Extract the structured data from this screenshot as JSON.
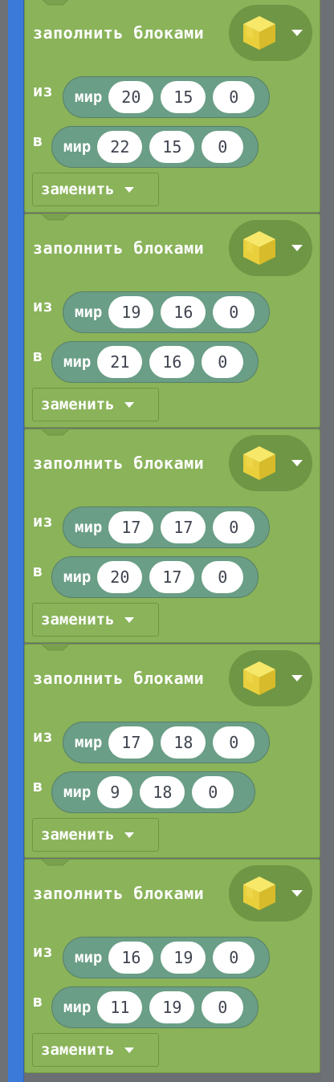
{
  "colors": {
    "block_green": "#8ab35a",
    "position_teal": "#6a9e86",
    "event_blue": "#3b7ad8",
    "cube_yellow": "#f2d844"
  },
  "blocks": [
    {
      "fill_label": "заполнить блоками",
      "block_icon": "gold-block-icon",
      "from_label": "из",
      "to_label": "в",
      "from": {
        "word": "мир",
        "x": "20",
        "y": "15",
        "z": "0"
      },
      "to": {
        "word": "мир",
        "x": "22",
        "y": "15",
        "z": "0"
      },
      "mode": "заменить"
    },
    {
      "fill_label": "заполнить блоками",
      "block_icon": "gold-block-icon",
      "from_label": "из",
      "to_label": "в",
      "from": {
        "word": "мир",
        "x": "19",
        "y": "16",
        "z": "0"
      },
      "to": {
        "word": "мир",
        "x": "21",
        "y": "16",
        "z": "0"
      },
      "mode": "заменить"
    },
    {
      "fill_label": "заполнить блоками",
      "block_icon": "gold-block-icon",
      "from_label": "из",
      "to_label": "в",
      "from": {
        "word": "мир",
        "x": "17",
        "y": "17",
        "z": "0"
      },
      "to": {
        "word": "мир",
        "x": "20",
        "y": "17",
        "z": "0"
      },
      "mode": "заменить"
    },
    {
      "fill_label": "заполнить блоками",
      "block_icon": "gold-block-icon",
      "from_label": "из",
      "to_label": "в",
      "from": {
        "word": "мир",
        "x": "17",
        "y": "18",
        "z": "0"
      },
      "to": {
        "word": "мир",
        "x": "9",
        "y": "18",
        "z": "0"
      },
      "mode": "заменить"
    },
    {
      "fill_label": "заполнить блоками",
      "block_icon": "gold-block-icon",
      "from_label": "из",
      "to_label": "в",
      "from": {
        "word": "мир",
        "x": "16",
        "y": "19",
        "z": "0"
      },
      "to": {
        "word": "мир",
        "x": "11",
        "y": "19",
        "z": "0"
      },
      "mode": "заменить"
    }
  ]
}
